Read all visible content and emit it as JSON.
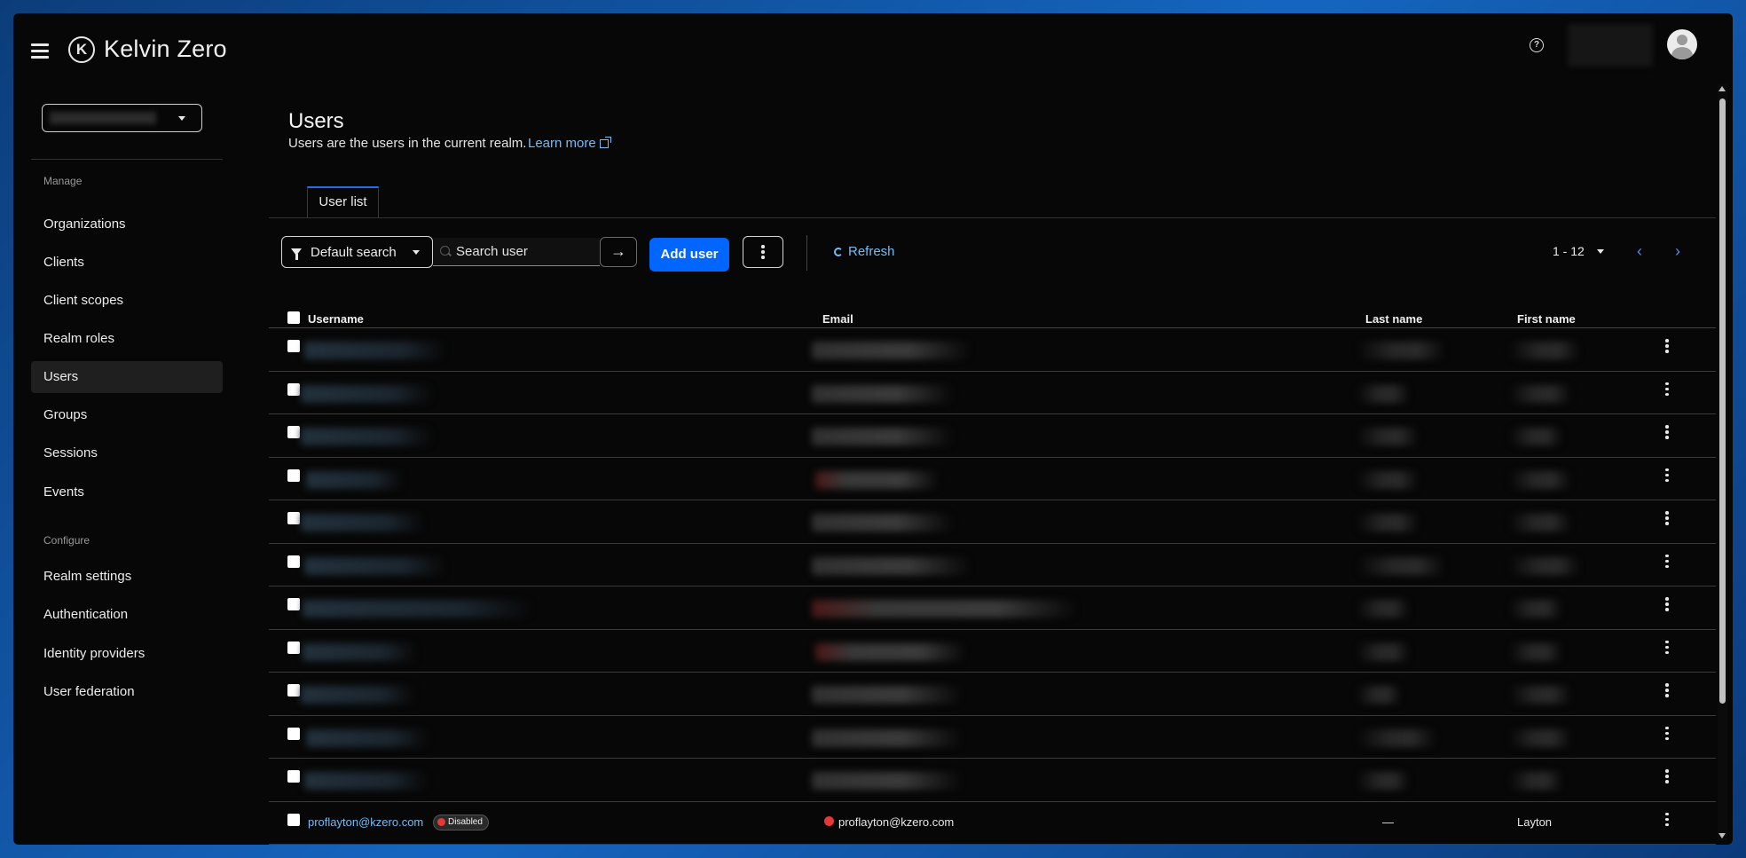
{
  "app": {
    "brand": "Kelvin Zero"
  },
  "sidebar": {
    "manage_label": "Manage",
    "configure_label": "Configure",
    "manage_items": [
      {
        "label": "Organizations",
        "active": false
      },
      {
        "label": "Clients",
        "active": false
      },
      {
        "label": "Client scopes",
        "active": false
      },
      {
        "label": "Realm roles",
        "active": false
      },
      {
        "label": "Users",
        "active": true
      },
      {
        "label": "Groups",
        "active": false
      },
      {
        "label": "Sessions",
        "active": false
      },
      {
        "label": "Events",
        "active": false
      }
    ],
    "configure_items": [
      {
        "label": "Realm settings"
      },
      {
        "label": "Authentication"
      },
      {
        "label": "Identity providers"
      },
      {
        "label": "User federation"
      }
    ]
  },
  "page": {
    "title": "Users",
    "description": "Users are the users in the current realm.",
    "learn_more": "Learn more"
  },
  "tabs": [
    {
      "label": "User list",
      "active": true
    }
  ],
  "toolbar": {
    "search_type": "Default search",
    "search_placeholder": "Search user",
    "go_glyph": "→",
    "add_user": "Add user",
    "refresh": "Refresh",
    "pagination": "1 - 12",
    "prev_glyph": "‹",
    "next_glyph": "›"
  },
  "table": {
    "columns": [
      "Username",
      "Email",
      "Last name",
      "First name"
    ],
    "last_row": {
      "username": "proflayton@kzero.com",
      "badge": "Disabled",
      "email": "proflayton@kzero.com",
      "last_name": "—",
      "first_name": "Layton"
    }
  },
  "colors": {
    "accent": "#0066ff",
    "link": "#73bcf7",
    "danger": "#e53935",
    "background": "#070707"
  }
}
